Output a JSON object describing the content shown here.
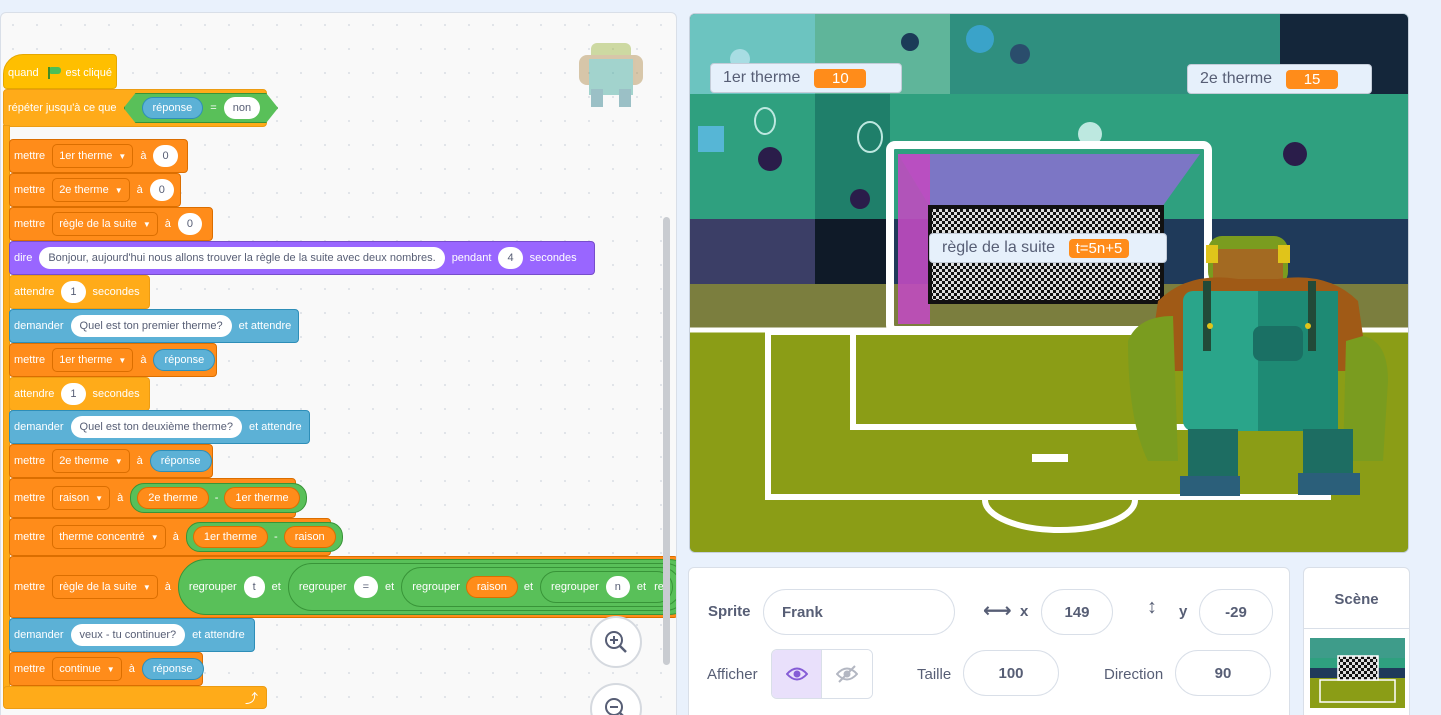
{
  "script": {
    "hat": {
      "when": "quand",
      "clicked": "est cliqué"
    },
    "repeat_until": {
      "label": "répéter jusqu'à ce que",
      "reporter": "réponse",
      "op": "=",
      "value": "non"
    },
    "set1": {
      "cmd": "mettre",
      "var": "1er therme",
      "to": "à",
      "value": "0"
    },
    "set2": {
      "cmd": "mettre",
      "var": "2e therme",
      "to": "à",
      "value": "0"
    },
    "set3": {
      "cmd": "mettre",
      "var": "règle de la suite",
      "to": "à",
      "value": "0"
    },
    "say": {
      "cmd": "dire",
      "text": "Bonjour, aujourd'hui nous allons trouver la règle de la suite avec deux nombres.",
      "for": "pendant",
      "secs": "4",
      "unit": "secondes"
    },
    "wait1": {
      "cmd": "attendre",
      "value": "1",
      "unit": "secondes"
    },
    "ask1": {
      "cmd": "demander",
      "text": "Quel est ton premier therme?",
      "wait": "et attendre"
    },
    "set4": {
      "cmd": "mettre",
      "var": "1er therme",
      "to": "à",
      "value": "réponse"
    },
    "wait2": {
      "cmd": "attendre",
      "value": "1",
      "unit": "secondes"
    },
    "ask2": {
      "cmd": "demander",
      "text": "Quel est ton deuxième therme?",
      "wait": "et attendre"
    },
    "set5": {
      "cmd": "mettre",
      "var": "2e therme",
      "to": "à",
      "value": "réponse"
    },
    "set6": {
      "cmd": "mettre",
      "var": "raison",
      "to": "à",
      "a": "2e therme",
      "op": "-",
      "b": "1er therme"
    },
    "set7": {
      "cmd": "mettre",
      "var": "therme concentré",
      "to": "à",
      "a": "1er therme",
      "op": "-",
      "b": "raison"
    },
    "set8": {
      "cmd": "mettre",
      "var": "règle de la suite",
      "to": "à",
      "join": "regrouper",
      "and": "et",
      "v1": "t",
      "v2": "=",
      "v3": "raison",
      "v4": "n",
      "tail": "re"
    },
    "ask3": {
      "cmd": "demander",
      "text": "veux - tu continuer?",
      "wait": "et attendre"
    },
    "set9": {
      "cmd": "mettre",
      "var": "continue",
      "to": "à",
      "value": "réponse"
    }
  },
  "stage": {
    "monitors": [
      {
        "label": "1er therme",
        "value": "10"
      },
      {
        "label": "2e therme",
        "value": "15"
      },
      {
        "label": "règle de la suite",
        "value": "t=5n+5"
      }
    ]
  },
  "sprite_info": {
    "sprite_label": "Sprite",
    "sprite_name": "Frank",
    "x_label": "x",
    "x_value": "149",
    "y_label": "y",
    "y_value": "-29",
    "show_label": "Afficher",
    "size_label": "Taille",
    "size_value": "100",
    "direction_label": "Direction",
    "direction_value": "90"
  },
  "stage_panel": {
    "title": "Scène"
  },
  "colors": {
    "events": "#ffbf00",
    "control": "#ffab19",
    "variables": "#ff8c1a",
    "looks": "#9966ff",
    "sensing": "#5cb1d6",
    "operators": "#59c059",
    "accent": "#855cd6"
  }
}
